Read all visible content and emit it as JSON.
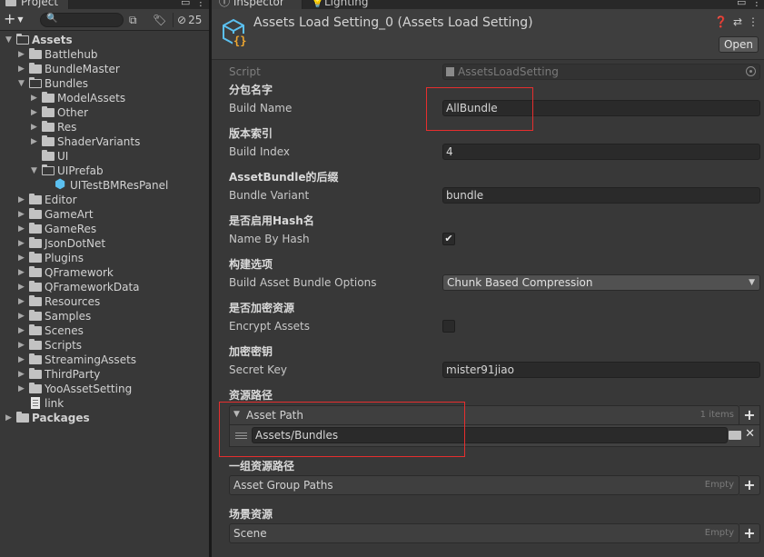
{
  "project": {
    "tab_label": "Project",
    "hidden_count": "25",
    "tree": [
      {
        "label": "Assets",
        "depth": 0,
        "expanded": true,
        "kind": "folder",
        "bold": true
      },
      {
        "label": "Battlehub",
        "depth": 1,
        "expanded": false,
        "kind": "folder"
      },
      {
        "label": "BundleMaster",
        "depth": 1,
        "expanded": false,
        "kind": "folder"
      },
      {
        "label": "Bundles",
        "depth": 1,
        "expanded": true,
        "kind": "folder"
      },
      {
        "label": "ModelAssets",
        "depth": 2,
        "expanded": false,
        "kind": "folder"
      },
      {
        "label": "Other",
        "depth": 2,
        "expanded": false,
        "kind": "folder"
      },
      {
        "label": "Res",
        "depth": 2,
        "expanded": false,
        "kind": "folder"
      },
      {
        "label": "ShaderVariants",
        "depth": 2,
        "expanded": false,
        "kind": "folder"
      },
      {
        "label": "UI",
        "depth": 2,
        "expanded": null,
        "kind": "folder"
      },
      {
        "label": "UIPrefab",
        "depth": 2,
        "expanded": true,
        "kind": "folder"
      },
      {
        "label": "UITestBMResPanel",
        "depth": 3,
        "expanded": null,
        "kind": "prefab"
      },
      {
        "label": "Editor",
        "depth": 1,
        "expanded": false,
        "kind": "folder"
      },
      {
        "label": "GameArt",
        "depth": 1,
        "expanded": false,
        "kind": "folder"
      },
      {
        "label": "GameRes",
        "depth": 1,
        "expanded": false,
        "kind": "folder"
      },
      {
        "label": "JsonDotNet",
        "depth": 1,
        "expanded": false,
        "kind": "folder"
      },
      {
        "label": "Plugins",
        "depth": 1,
        "expanded": false,
        "kind": "folder"
      },
      {
        "label": "QFramework",
        "depth": 1,
        "expanded": false,
        "kind": "folder"
      },
      {
        "label": "QFrameworkData",
        "depth": 1,
        "expanded": false,
        "kind": "folder"
      },
      {
        "label": "Resources",
        "depth": 1,
        "expanded": false,
        "kind": "folder"
      },
      {
        "label": "Samples",
        "depth": 1,
        "expanded": false,
        "kind": "folder"
      },
      {
        "label": "Scenes",
        "depth": 1,
        "expanded": false,
        "kind": "folder"
      },
      {
        "label": "Scripts",
        "depth": 1,
        "expanded": false,
        "kind": "folder"
      },
      {
        "label": "StreamingAssets",
        "depth": 1,
        "expanded": false,
        "kind": "folder"
      },
      {
        "label": "ThirdParty",
        "depth": 1,
        "expanded": false,
        "kind": "folder"
      },
      {
        "label": "YooAssetSetting",
        "depth": 1,
        "expanded": false,
        "kind": "folder"
      },
      {
        "label": "link",
        "depth": 1,
        "expanded": null,
        "kind": "file"
      },
      {
        "label": "Packages",
        "depth": 0,
        "expanded": false,
        "kind": "folder",
        "bold": true
      }
    ]
  },
  "inspector": {
    "tab_inspector": "Inspector",
    "tab_lighting": "Lighting",
    "object_title": "Assets Load Setting_0 (Assets Load Setting)",
    "open_label": "Open",
    "script_label": "Script",
    "script_value": "AssetsLoadSetting",
    "build_name_cn": "分包名字",
    "build_name_label": "Build Name",
    "build_name_value": "AllBundle",
    "build_index_cn": "版本索引",
    "build_index_label": "Build Index",
    "build_index_value": "4",
    "bundle_variant_cn": "AssetBundle的后缀",
    "bundle_variant_label": "Bundle Variant",
    "bundle_variant_value": "bundle",
    "name_by_hash_cn": "是否启用Hash名",
    "name_by_hash_label": "Name By Hash",
    "name_by_hash_checked": true,
    "build_options_cn": "构建选项",
    "build_options_label": "Build Asset Bundle Options",
    "build_options_value": "Chunk Based Compression",
    "encrypt_cn": "是否加密资源",
    "encrypt_label": "Encrypt Assets",
    "encrypt_checked": false,
    "secret_key_cn": "加密密钥",
    "secret_key_label": "Secret Key",
    "secret_key_value": "mister91jiao",
    "asset_path_cn": "资源路径",
    "asset_path_label": "Asset Path",
    "asset_path_count": "1 items",
    "asset_path_item": "Assets/Bundles",
    "group_paths_cn": "一组资源路径",
    "group_paths_label": "Asset Group Paths",
    "group_paths_empty": "Empty",
    "scene_cn": "场景资源",
    "scene_label": "Scene",
    "scene_empty": "Empty"
  },
  "colors": {
    "highlight": "#e62e2e",
    "prefab_icon": "#5bc0f0"
  }
}
